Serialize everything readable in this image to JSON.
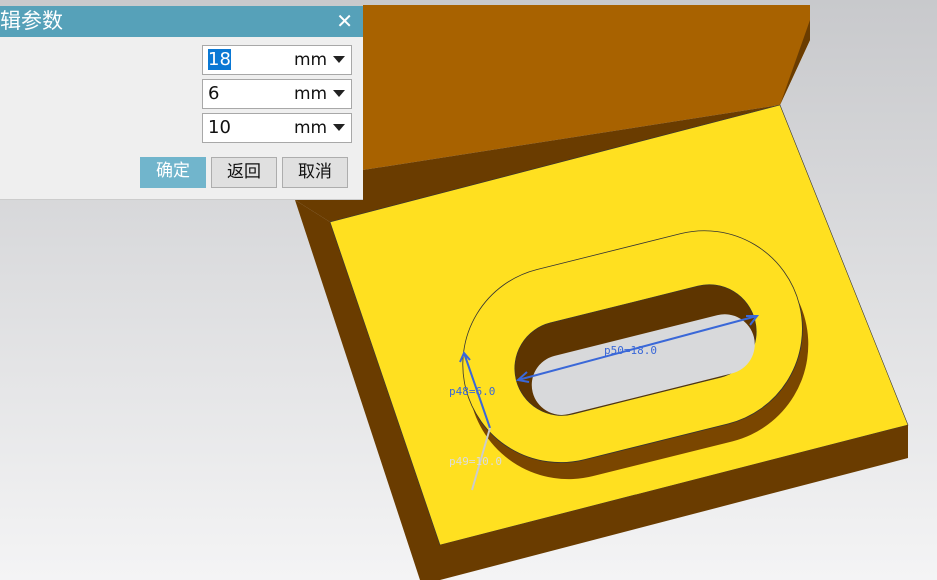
{
  "dialog": {
    "title": "辑参数",
    "close_icon": "close-icon",
    "fields": [
      {
        "value": "18",
        "unit": "mm"
      },
      {
        "value": "6",
        "unit": "mm"
      },
      {
        "value": "10",
        "unit": "mm"
      }
    ],
    "buttons": {
      "ok": "确定",
      "back": "返回",
      "cancel": "取消"
    }
  },
  "viewport": {
    "dimensions": {
      "p50": "p50=18.0",
      "p48": "p48=6.0",
      "p49": "p49=10.0"
    },
    "colors": {
      "top_face": "#ffe020",
      "side_face": "#6a3c00",
      "back_face": "#a86200",
      "dimension": "#3a68d8"
    }
  }
}
